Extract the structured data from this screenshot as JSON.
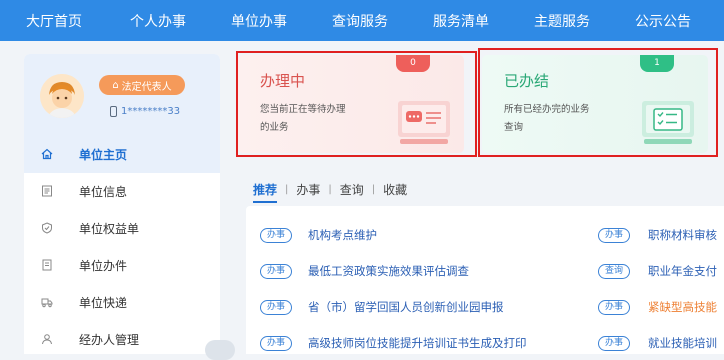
{
  "nav": {
    "items": [
      "大厅首页",
      "个人办事",
      "单位办事",
      "查询服务",
      "服务清单",
      "主题服务",
      "公示公告"
    ]
  },
  "profile": {
    "badge": "法定代表人",
    "phone": "1********33"
  },
  "sidebar": {
    "items": [
      {
        "label": "单位主页",
        "icon": "home-icon",
        "active": true
      },
      {
        "label": "单位信息",
        "icon": "document-icon"
      },
      {
        "label": "单位权益单",
        "icon": "shield-icon"
      },
      {
        "label": "单位办件",
        "icon": "file-icon"
      },
      {
        "label": "单位快递",
        "icon": "truck-icon"
      },
      {
        "label": "经办人管理",
        "icon": "person-icon"
      }
    ]
  },
  "cards": {
    "processing": {
      "title": "办理中",
      "count": "0",
      "desc": "您当前正在等待办理的业务"
    },
    "done": {
      "title": "已办结",
      "count": "1",
      "desc": "所有已经办完的业务查询"
    }
  },
  "tabs": {
    "items": [
      "推荐",
      "办事",
      "查询",
      "收藏"
    ]
  },
  "services": {
    "left": [
      {
        "tag": "办事",
        "name": "机构考点维护"
      },
      {
        "tag": "办事",
        "name": "最低工资政策实施效果评估调查"
      },
      {
        "tag": "办事",
        "name": "省（市）留学回国人员创新创业园申报"
      },
      {
        "tag": "办事",
        "name": "高级技师岗位技能提升培训证书生成及打印"
      }
    ],
    "right": [
      {
        "tag": "办事",
        "name": "职称材料审核",
        "hot": false
      },
      {
        "tag": "查询",
        "name": "职业年金支付",
        "hot": false
      },
      {
        "tag": "办事",
        "name": "紧缺型高技能",
        "hot": true
      },
      {
        "tag": "办事",
        "name": "就业技能培训",
        "hot": false
      }
    ]
  },
  "colors": {
    "nav": "#2f8ae5",
    "accent": "#1f6fd1",
    "processing": "#d9534f",
    "done": "#2aa876",
    "highlight": "#e02020"
  }
}
